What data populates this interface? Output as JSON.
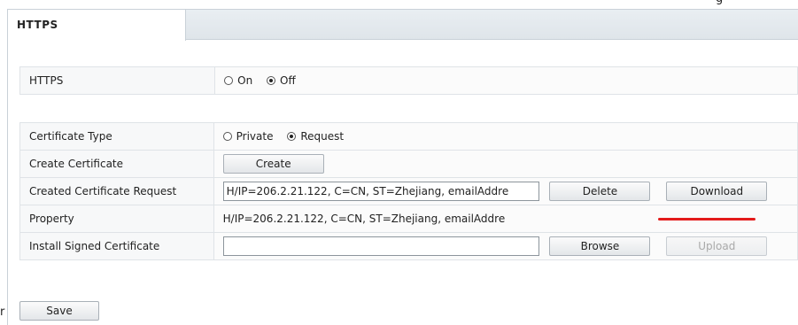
{
  "top_cut_text": "g",
  "tab": {
    "label": "HTTPS"
  },
  "https": {
    "label": "HTTPS",
    "options": [
      "On",
      "Off"
    ],
    "selected": "Off"
  },
  "certificate_type": {
    "label": "Certificate Type",
    "options": [
      "Private",
      "Request"
    ],
    "selected": "Request"
  },
  "create_certificate": {
    "label": "Create Certificate",
    "button": "Create"
  },
  "created_request": {
    "label": "Created Certificate Request",
    "value": "H/IP=206.2.21.122, C=CN, ST=Zhejiang, emailAddre",
    "delete_button": "Delete",
    "download_button": "Download"
  },
  "property": {
    "label": "Property",
    "value": "H/IP=206.2.21.122, C=CN, ST=Zhejiang, emailAddre"
  },
  "install_signed": {
    "label": "Install Signed Certificate",
    "value": "",
    "browse_button": "Browse",
    "upload_button": "Upload"
  },
  "save_button": "Save",
  "stray_text": "r",
  "colors": {
    "highlight_underline": "#e31b1b"
  }
}
